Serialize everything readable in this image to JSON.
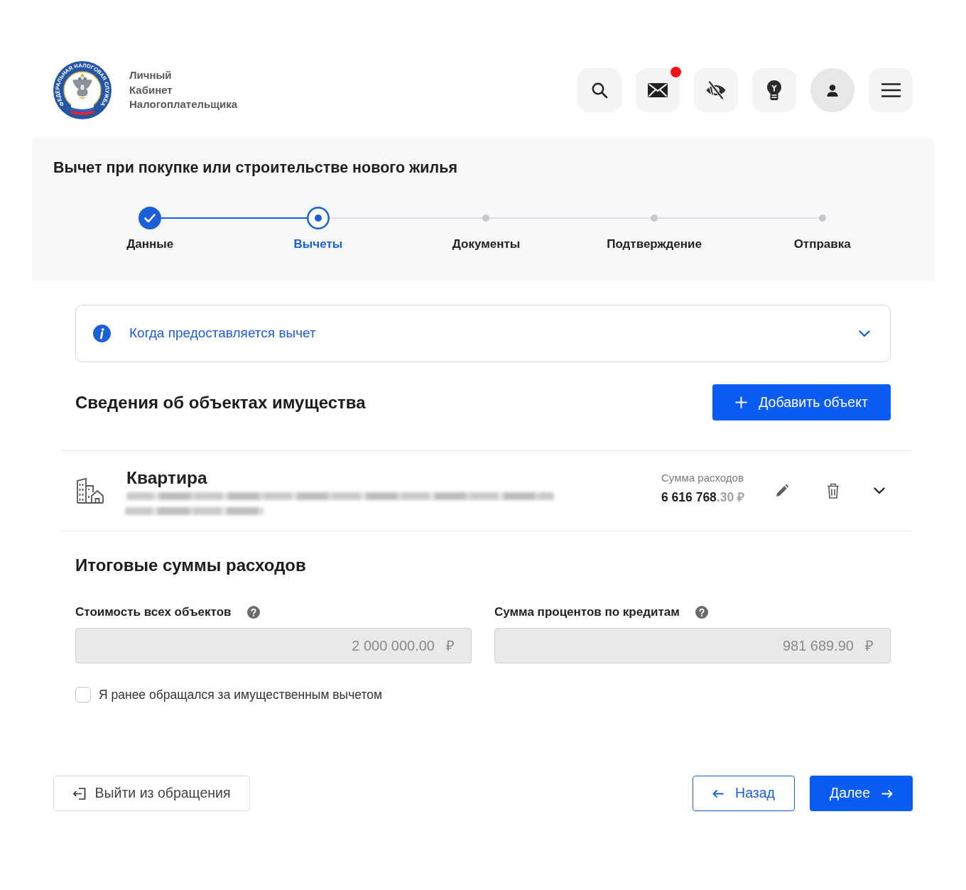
{
  "header": {
    "logo_text": "ФЕДЕРАЛЬНАЯ НАЛОГОВАЯ СЛУЖБА",
    "brand_lines": [
      "Личный",
      "Кабинет",
      "Налогоплательщика"
    ],
    "buttons": [
      {
        "kind": "search",
        "notification": false
      },
      {
        "kind": "mail",
        "notification": true
      },
      {
        "kind": "eye",
        "notification": false
      },
      {
        "kind": "bulb",
        "notification": false
      },
      {
        "kind": "profile",
        "notification": false
      },
      {
        "kind": "menu",
        "notification": false
      }
    ]
  },
  "page_title": "Вычет при покупке или строительстве нового жилья",
  "steps": [
    {
      "label": "Данные",
      "completed": true,
      "selected": false
    },
    {
      "label": "Вычеты",
      "completed": false,
      "selected": true
    },
    {
      "label": "Документы",
      "completed": false,
      "selected": false
    },
    {
      "label": "Подтверждение",
      "completed": false,
      "selected": false
    },
    {
      "label": "Отправка",
      "completed": false,
      "selected": false
    }
  ],
  "info_panel": {
    "title": "Когда предоставляется вычет",
    "expanded": false
  },
  "properties": {
    "heading": "Сведения об объектах имущества",
    "add_button": "Добавить объект",
    "items": [
      {
        "title": "Квартира",
        "expense_label": "Сумма расходов",
        "amount": "6 616 768",
        "amount_fraction": ".30",
        "currency": "₽",
        "expanded": false
      }
    ]
  },
  "totals": {
    "heading": "Итоговые суммы расходов",
    "fields": [
      {
        "label": "Стоимость всех объектов",
        "value": "2 000 000.00",
        "currency": "₽",
        "disabled": true
      },
      {
        "label": "Сумма процентов по кредитам",
        "value": "981 689.90",
        "currency": "₽",
        "disabled": true
      }
    ]
  },
  "checkbox": {
    "label": "Я ранее обращался за имущественным вычетом",
    "checked": false
  },
  "footer": {
    "exit_button": "Выйти из обращения",
    "back_button": "Назад",
    "next_button": "Далее"
  }
}
